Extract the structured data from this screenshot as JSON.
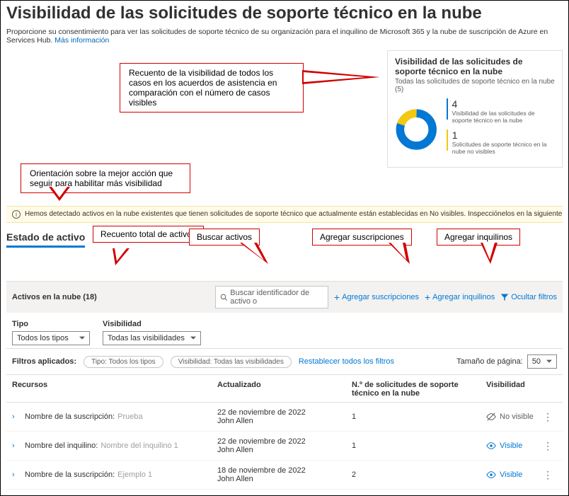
{
  "page": {
    "title": "Visibilidad de las solicitudes de soporte técnico en la nube",
    "subtitle": "Proporcione su consentimiento para ver las solicitudes de soporte técnico de su organización para el inquilino de Microsoft 365 y la nube de suscripción de Azure en Services Hub.",
    "more_info": "Más información"
  },
  "callouts": {
    "donut": "Recuento de la visibilidad de todos los casos en los acuerdos de asistencia en comparación con el número de casos visibles",
    "guidance": "Orientación sobre la mejor acción que seguir para habilitar más visibilidad",
    "count": "Recuento total de activos",
    "search": "Buscar activos",
    "subs": "Agregar suscripciones",
    "tenants": "Agregar inquilinos"
  },
  "donut": {
    "title": "Visibilidad de las solicitudes de soporte técnico en la nube",
    "subtitle": "Todas las solicitudes de soporte técnico en la nube (5)",
    "visible_count": "4",
    "visible_label": "Visibilidad de las solicitudes de soporte técnico en la nube",
    "notvisible_count": "1",
    "notvisible_label": "Solicitudes de soporte técnico en la nube no visibles"
  },
  "chart_data": {
    "type": "pie",
    "title": "Visibilidad de las solicitudes de soporte técnico en la nube",
    "series": [
      {
        "name": "Visibilidad de las solicitudes de soporte técnico en la nube",
        "value": 4,
        "color": "#0078d4"
      },
      {
        "name": "Solicitudes de soporte técnico en la nube no visibles",
        "value": 1,
        "color": "#f2c811"
      }
    ],
    "total": 5
  },
  "info_bar": "Hemos detectado activos en la nube existentes que tienen solicitudes de soporte técnico que actualmente están establecidas en No visibles. Inspecciónelos en la siguiente lista y márquelos como Visibles para habilitar la visibi",
  "tabs": {
    "active": "Estado de activo"
  },
  "toolbar": {
    "assets_title": "Activos en la nube (18)",
    "search_placeholder": "Buscar identificador de activo o",
    "add_subs": "Agregar suscripciones",
    "add_tenants": "Agregar inquilinos",
    "hide_filters": "Ocultar filtros"
  },
  "filters": {
    "type_label": "Tipo",
    "type_value": "Todos los tipos",
    "vis_label": "Visibilidad",
    "vis_value": "Todas las visibilidades"
  },
  "applied": {
    "label": "Filtros aplicados:",
    "chip_type": "Tipo: Todos los tipos",
    "chip_vis": "Visibilidad: Todas las visibilidades",
    "reset": "Restablecer todos los filtros",
    "page_size_label": "Tamaño de página:",
    "page_size_value": "50"
  },
  "columns": {
    "res": "Recursos",
    "upd": "Actualizado",
    "req": "N.º de solicitudes de soporte técnico en la nube",
    "vis": "Visibilidad"
  },
  "rows": [
    {
      "label": "Nombre de la suscripción:",
      "value": "Prueba",
      "updated_date": "22 de noviembre de 2022",
      "updated_by": "John Allen",
      "requests": "1",
      "visibility": "No visible",
      "vis_kind": "nv"
    },
    {
      "label": "Nombre del inquilino:",
      "value": "Nombre del inquilino 1",
      "updated_date": "22 de noviembre de 2022",
      "updated_by": "John Allen",
      "requests": "1",
      "visibility": "Visible",
      "vis_kind": "v"
    },
    {
      "label": "Nombre de la suscripción:",
      "value": "Ejemplo 1",
      "updated_date": "18 de noviembre de 2022",
      "updated_by": "John Allen",
      "requests": "2",
      "visibility": "Visible",
      "vis_kind": "v"
    }
  ]
}
